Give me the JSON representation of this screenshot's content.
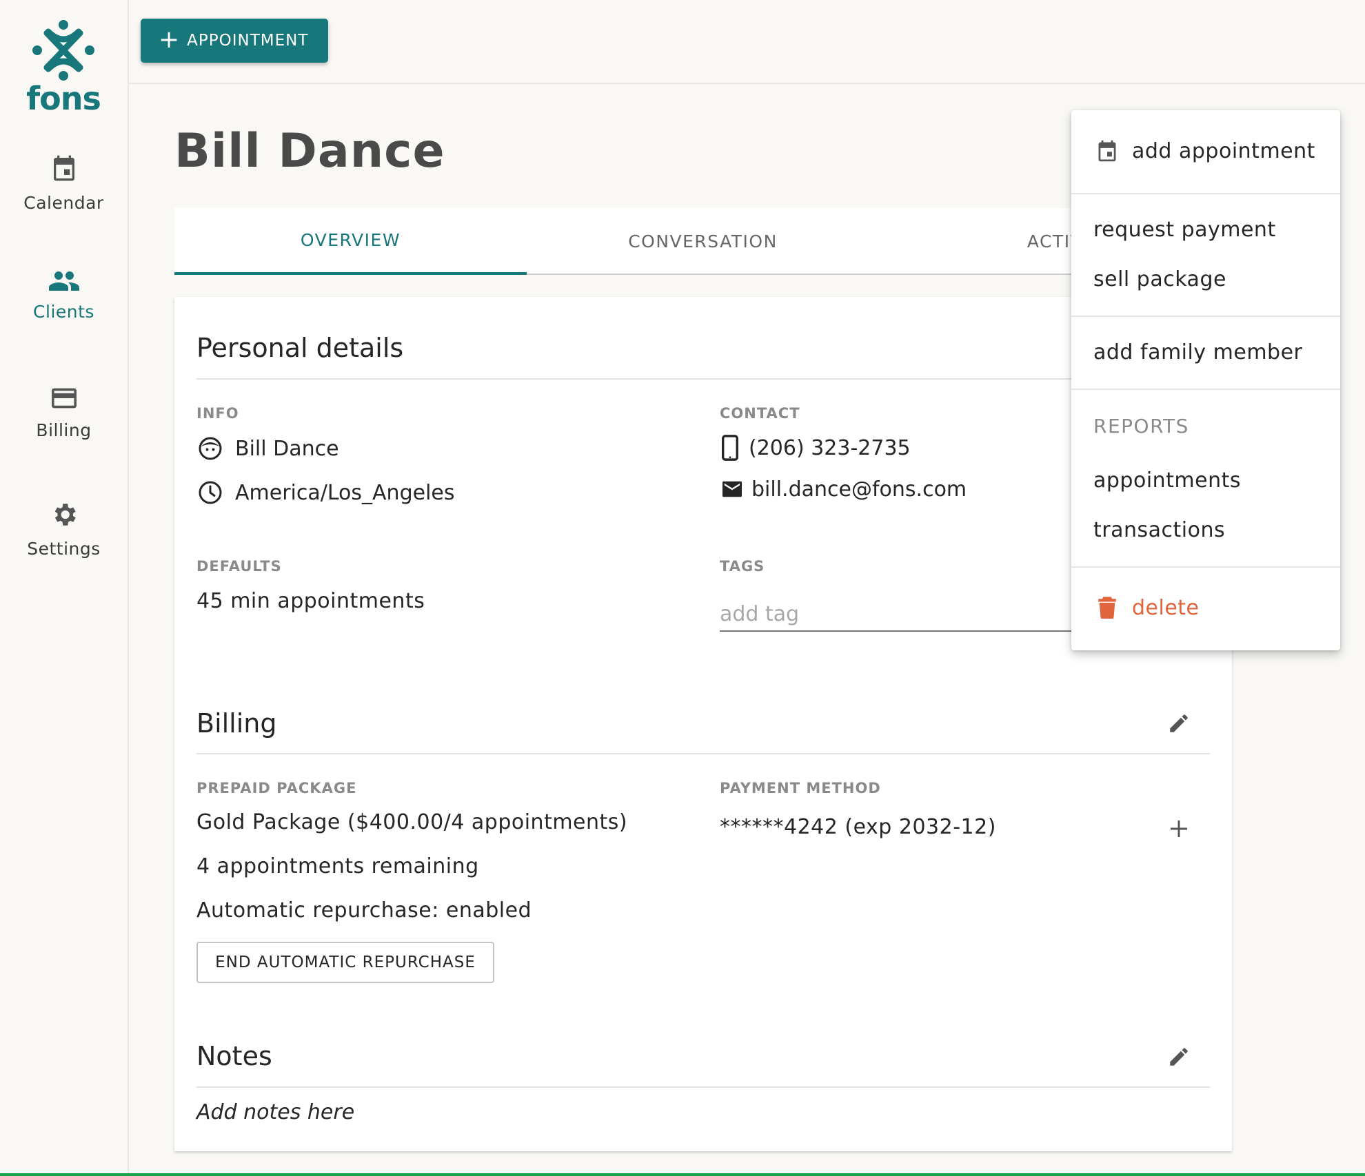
{
  "brand": {
    "name": "fons",
    "color": "#17777a"
  },
  "sidebar": {
    "items": [
      {
        "label": "Calendar",
        "icon": "calendar-icon"
      },
      {
        "label": "Clients",
        "icon": "people-icon",
        "active": true
      },
      {
        "label": "Billing",
        "icon": "credit-card-icon"
      },
      {
        "label": "Settings",
        "icon": "gear-icon"
      }
    ]
  },
  "topbar": {
    "appointment_button": "APPOINTMENT"
  },
  "client": {
    "name": "Bill Dance"
  },
  "tabs": [
    {
      "label": "OVERVIEW",
      "active": true
    },
    {
      "label": "CONVERSATION"
    },
    {
      "label": "ACTIV"
    }
  ],
  "personal_details": {
    "title": "Personal details",
    "info_label": "INFO",
    "name": "Bill Dance",
    "timezone": "America/Los_Angeles",
    "contact_label": "CONTACT",
    "phone": "(206) 323-2735",
    "email": "bill.dance@fons.com",
    "defaults_label": "DEFAULTS",
    "defaults_value": "45 min appointments",
    "tags_label": "TAGS",
    "tag_placeholder": "add tag"
  },
  "billing": {
    "title": "Billing",
    "package_label": "PREPAID PACKAGE",
    "package_value": "Gold Package ($400.00/4 appointments)",
    "remaining": "4 appointments remaining",
    "repurchase": "Automatic repurchase: enabled",
    "end_repurchase_button": "END AUTOMATIC REPURCHASE",
    "payment_label": "PAYMENT METHOD",
    "payment_value": "******4242 (exp 2032-12)"
  },
  "notes": {
    "title": "Notes",
    "placeholder": "Add notes here"
  },
  "menu": {
    "add_appointment": "add appointment",
    "request_payment": "request payment",
    "sell_package": "sell package",
    "add_family_member": "add family member",
    "reports_header": "REPORTS",
    "appointments": "appointments",
    "transactions": "transactions",
    "delete": "delete",
    "delete_color": "#e0643c"
  }
}
